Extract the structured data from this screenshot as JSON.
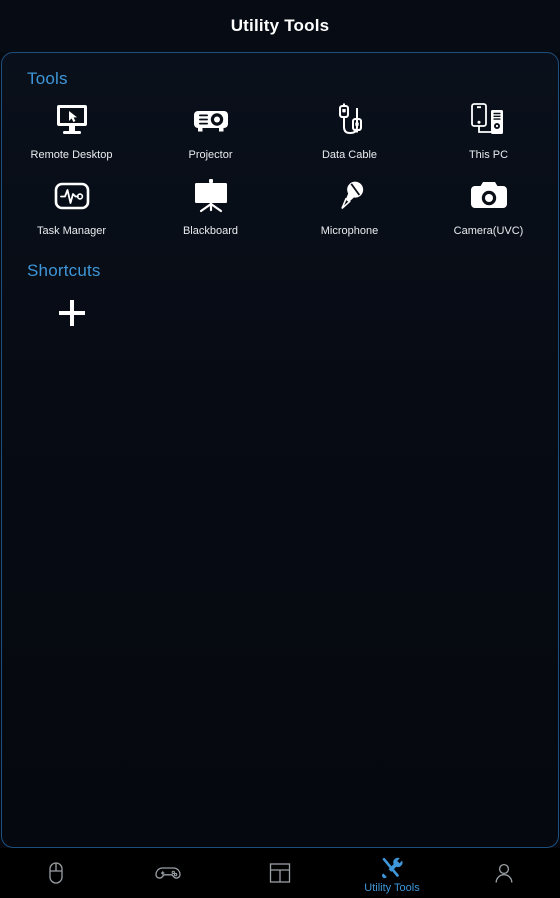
{
  "header": {
    "title": "Utility Tools"
  },
  "sections": {
    "tools": {
      "title": "Tools",
      "items": [
        {
          "label": "Remote Desktop",
          "icon": "remote-desktop-icon"
        },
        {
          "label": "Projector",
          "icon": "projector-icon"
        },
        {
          "label": "Data Cable",
          "icon": "data-cable-icon"
        },
        {
          "label": "This PC",
          "icon": "this-pc-icon"
        },
        {
          "label": "Task Manager",
          "icon": "task-manager-icon"
        },
        {
          "label": "Blackboard",
          "icon": "blackboard-icon"
        },
        {
          "label": "Microphone",
          "icon": "microphone-icon"
        },
        {
          "label": "Camera(UVC)",
          "icon": "camera-icon"
        }
      ]
    },
    "shortcuts": {
      "title": "Shortcuts",
      "add_icon": "plus-icon",
      "items": []
    }
  },
  "navbar": {
    "items": [
      {
        "label": "",
        "icon": "mouse-icon",
        "active": false
      },
      {
        "label": "",
        "icon": "gamepad-icon",
        "active": false
      },
      {
        "label": "",
        "icon": "layout-panel-icon",
        "active": false
      },
      {
        "label": "Utility Tools",
        "icon": "tools-wrench-screwdriver-icon",
        "active": true
      },
      {
        "label": "",
        "icon": "person-icon",
        "active": false
      }
    ]
  },
  "colors": {
    "accent": "#3f96d8",
    "panel_border": "#1c4f7e",
    "background": "#05080e",
    "icon_white": "#ffffff",
    "nav_inactive": "#9aa0a6"
  }
}
